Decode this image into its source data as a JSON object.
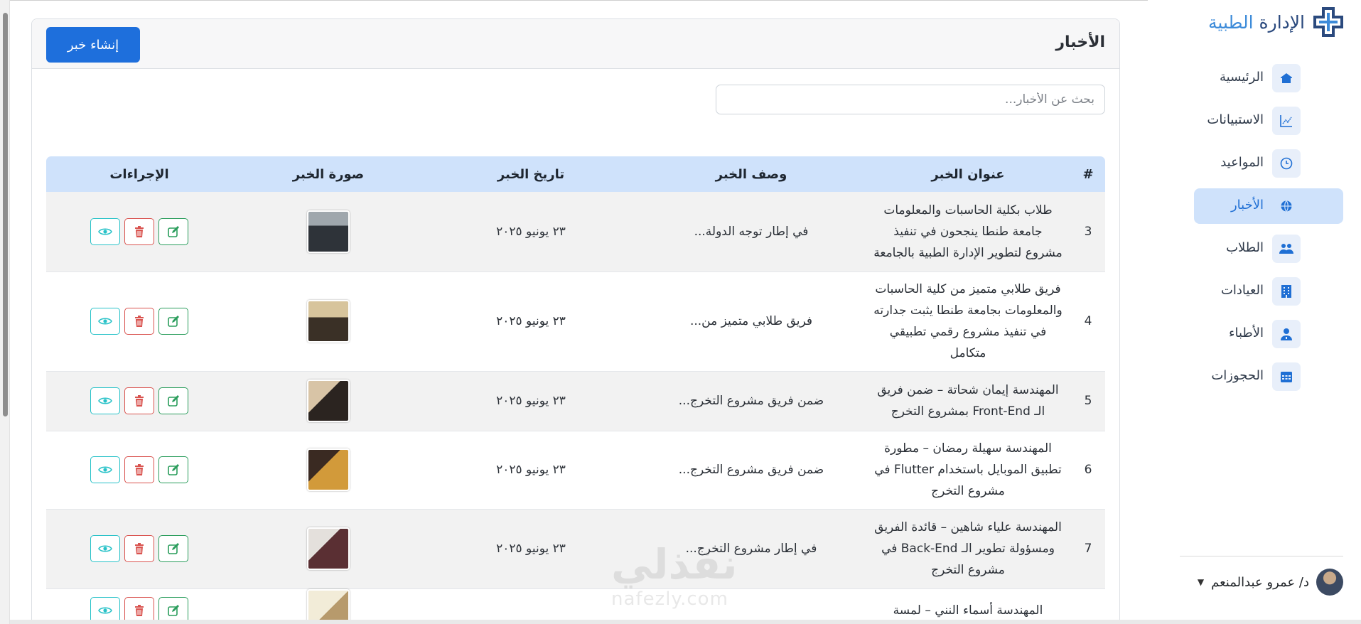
{
  "brand": {
    "name_main": "الإدارة",
    "name_accent": "الطبية"
  },
  "sidebar": {
    "items": [
      {
        "label": "الرئيسية",
        "icon": "home-icon",
        "active": false
      },
      {
        "label": "الاستبيانات",
        "icon": "chart-icon",
        "active": false
      },
      {
        "label": "المواعيد",
        "icon": "clock-icon",
        "active": false
      },
      {
        "label": "الأخبار",
        "icon": "globe-icon",
        "active": true
      },
      {
        "label": "الطلاب",
        "icon": "students-icon",
        "active": false
      },
      {
        "label": "العيادات",
        "icon": "building-icon",
        "active": false
      },
      {
        "label": "الأطباء",
        "icon": "doctor-icon",
        "active": false
      },
      {
        "label": "الحجوزات",
        "icon": "calendar-icon",
        "active": false
      }
    ],
    "user": {
      "name": "د/ عمرو عبدالمنعم"
    }
  },
  "header": {
    "title": "الأخبار",
    "create_label": "إنشاء خبر"
  },
  "search": {
    "placeholder": "بحث عن الأخبار..."
  },
  "table": {
    "headers": {
      "num": "#",
      "title": "عنوان الخبر",
      "desc": "وصف الخبر",
      "date": "تاريخ الخبر",
      "image": "صورة الخبر",
      "actions": "الإجراءات"
    },
    "rows": [
      {
        "num": "3",
        "title": "طلاب بكلية الحاسبات والمعلومات جامعة طنطا ينجحون في تنفيذ مشروع لتطوير الإدارة الطبية بالجامعة",
        "desc": "في إطار توجه الدولة...",
        "date": "٢٣ يونيو ٢٠٢٥"
      },
      {
        "num": "4",
        "title": "فريق طلابي متميز من كلية الحاسبات والمعلومات بجامعة طنطا يثبت جدارته في تنفيذ مشروع رقمي تطبيقي متكامل",
        "desc": "فريق طلابي متميز من...",
        "date": "٢٣ يونيو ٢٠٢٥"
      },
      {
        "num": "5",
        "title": "المهندسة إيمان شحاتة – ضمن فريق الـ Front-End بمشروع التخرج",
        "desc": "ضمن فريق مشروع التخرج...",
        "date": "٢٣ يونيو ٢٠٢٥"
      },
      {
        "num": "6",
        "title": "المهندسة سهيلة رمضان – مطورة تطبيق الموبايل باستخدام Flutter في مشروع التخرج",
        "desc": "ضمن فريق مشروع التخرج...",
        "date": "٢٣ يونيو ٢٠٢٥"
      },
      {
        "num": "7",
        "title": "المهندسة علياء شاهين – قائدة الفريق ومسؤولة تطوير الـ Back-End في مشروع التخرج",
        "desc": "في إطار مشروع التخرج...",
        "date": "٢٣ يونيو ٢٠٢٥"
      },
      {
        "num": "",
        "title": "المهندسة أسماء النني – لمسة",
        "desc": "",
        "date": ""
      }
    ]
  },
  "watermark": {
    "big": "نفذلي",
    "small": "nafezly.com"
  },
  "colors": {
    "primary": "#1e6fdc",
    "header_bg": "#cfe2fb",
    "view": "#28c2c8",
    "delete": "#d9534f",
    "edit": "#2a9d5c"
  }
}
